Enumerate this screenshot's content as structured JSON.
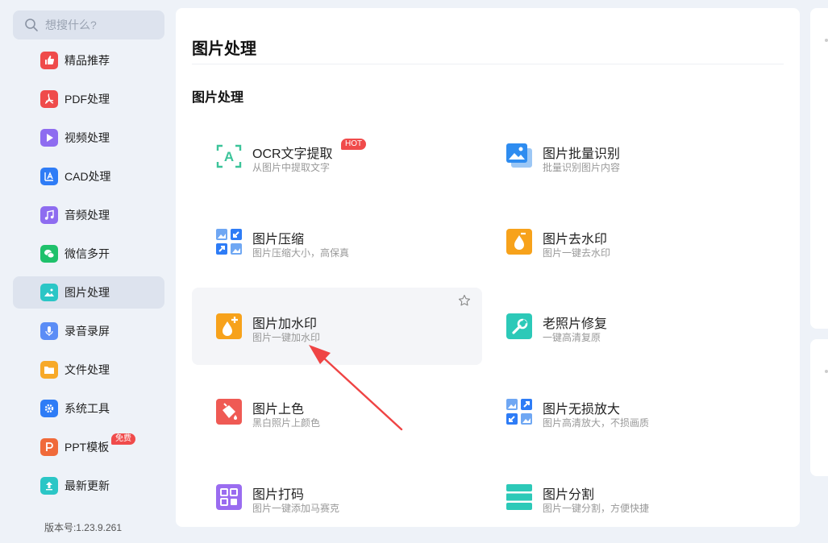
{
  "search": {
    "placeholder": "想搜什么?"
  },
  "sidebar": {
    "items": [
      {
        "label": "精品推荐",
        "icon": "thumbs-up-icon",
        "color": "#ef4b4b"
      },
      {
        "label": "PDF处理",
        "icon": "pdf-icon",
        "color": "#ef4b4b"
      },
      {
        "label": "视频处理",
        "icon": "play-icon",
        "color": "#8e6cf0"
      },
      {
        "label": "CAD处理",
        "icon": "cad-icon",
        "color": "#2e7cf6"
      },
      {
        "label": "音频处理",
        "icon": "music-note-icon",
        "color": "#8e6cf0"
      },
      {
        "label": "微信多开",
        "icon": "wechat-icon",
        "color": "#1fc16b"
      },
      {
        "label": "图片处理",
        "icon": "image-icon",
        "color": "#2bc6c6"
      },
      {
        "label": "录音录屏",
        "icon": "microphone-icon",
        "color": "#5b8df6"
      },
      {
        "label": "文件处理",
        "icon": "folder-icon",
        "color": "#f7a928"
      },
      {
        "label": "系统工具",
        "icon": "gear-icon",
        "color": "#2e7cf6"
      },
      {
        "label": "PPT模板",
        "icon": "ppt-icon",
        "color": "#f06a3a",
        "badge": "免费"
      },
      {
        "label": "最新更新",
        "icon": "upload-icon",
        "color": "#2bc6c6"
      }
    ],
    "active_index": 6
  },
  "version": "版本号:1.23.9.261",
  "main": {
    "title": "图片处理",
    "section_title": "图片处理",
    "tools": [
      {
        "name": "OCR文字提取",
        "desc": "从图片中提取文字",
        "icon": "ocr-icon",
        "badge": "HOT"
      },
      {
        "name": "图片批量识别",
        "desc": "批量识别图片内容",
        "icon": "images-stack-icon"
      },
      {
        "name": "图片压缩",
        "desc": "图片压缩大小，高保真",
        "icon": "compress-icon"
      },
      {
        "name": "图片去水印",
        "desc": "图片一键去水印",
        "icon": "remove-watermark-icon"
      },
      {
        "name": "图片加水印",
        "desc": "图片一键加水印",
        "icon": "add-watermark-icon"
      },
      {
        "name": "老照片修复",
        "desc": "一键高清复原",
        "icon": "repair-icon"
      },
      {
        "name": "图片上色",
        "desc": "黑白照片上颜色",
        "icon": "paint-bucket-icon"
      },
      {
        "name": "图片无损放大",
        "desc": "图片高清放大，不损画质",
        "icon": "enlarge-icon"
      },
      {
        "name": "图片打码",
        "desc": "图片一键添加马赛克",
        "icon": "mosaic-icon"
      },
      {
        "name": "图片分割",
        "desc": "图片一键分割，方便快捷",
        "icon": "split-icon"
      }
    ]
  },
  "colors": {
    "background": "#eef2f8",
    "active_nav": "#dde3ee",
    "hot_badge": "#f04b4b",
    "annotation_arrow": "#ef4444"
  }
}
